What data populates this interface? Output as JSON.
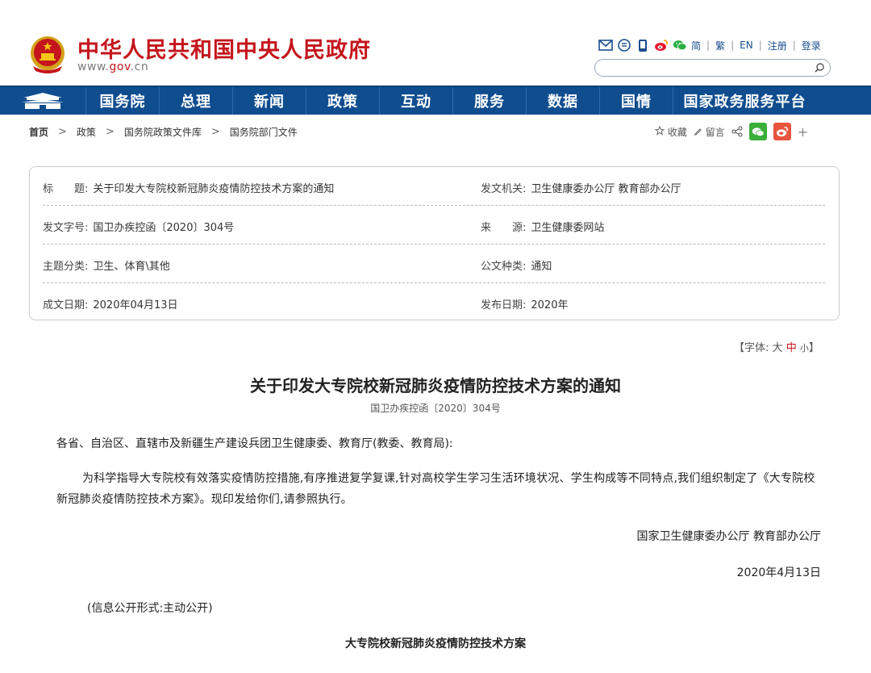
{
  "header": {
    "site_title": "中华人民共和国中央人民政府",
    "site_url_pre": "www.",
    "site_url_mid": "gov",
    "site_url_post": ".cn",
    "lang_links": [
      "简",
      "繁",
      "EN",
      "注册",
      "登录"
    ],
    "tool_icons": [
      "mail-icon",
      "feed-icon",
      "mobile-icon",
      "weibo-icon",
      "wechat-icon"
    ]
  },
  "nav": {
    "items": [
      "国务院",
      "总理",
      "新闻",
      "政策",
      "互动",
      "服务",
      "数据",
      "国情",
      "国家政务服务平台"
    ]
  },
  "breadcrumb": [
    "首页",
    "政策",
    "国务院政策文件库",
    "国务院部门文件"
  ],
  "share": {
    "favorite": "收藏",
    "comment": "留言",
    "more": "+"
  },
  "info": {
    "title_label": "标　　题:",
    "title_value": "关于印发大专院校新冠肺炎疫情防控技术方案的通知",
    "issuer_label": "发文机关:",
    "issuer_value": "卫生健康委办公厅 教育部办公厅",
    "docno_label": "发文字号:",
    "docno_value": "国卫办疾控函〔2020〕304号",
    "source_label": "来　　源:",
    "source_value": "卫生健康委网站",
    "topic_label": "主题分类:",
    "topic_value": "卫生、体育\\其他",
    "type_label": "公文种类:",
    "type_value": "通知",
    "created_label": "成文日期:",
    "created_value": "2020年04月13日",
    "published_label": "发布日期:",
    "published_value": "2020年"
  },
  "fontsize": {
    "prefix": "【字体:",
    "large": "大",
    "medium": "中",
    "small": "小",
    "suffix": "】"
  },
  "article": {
    "title": "关于印发大专院校新冠肺炎疫情防控技术方案的通知",
    "doc_no": "国卫办疾控函〔2020〕304号",
    "greeting": "各省、自治区、直辖市及新疆生产建设兵团卫生健康委、教育厅(教委、教育局):",
    "body": "为科学指导大专院校有效落实疫情防控措施,有序推进复学复课,针对高校学生学习生活环境状况、学生构成等不同特点,我们组织制定了《大专院校新冠肺炎疫情防控技术方案》。现印发给你们,请参照执行。",
    "signature": "国家卫生健康委办公厅 教育部办公厅",
    "date": "2020年4月13日",
    "disclosure": "(信息公开形式:主动公开)",
    "subtitle": "大专院校新冠肺炎疫情防控技术方案"
  }
}
